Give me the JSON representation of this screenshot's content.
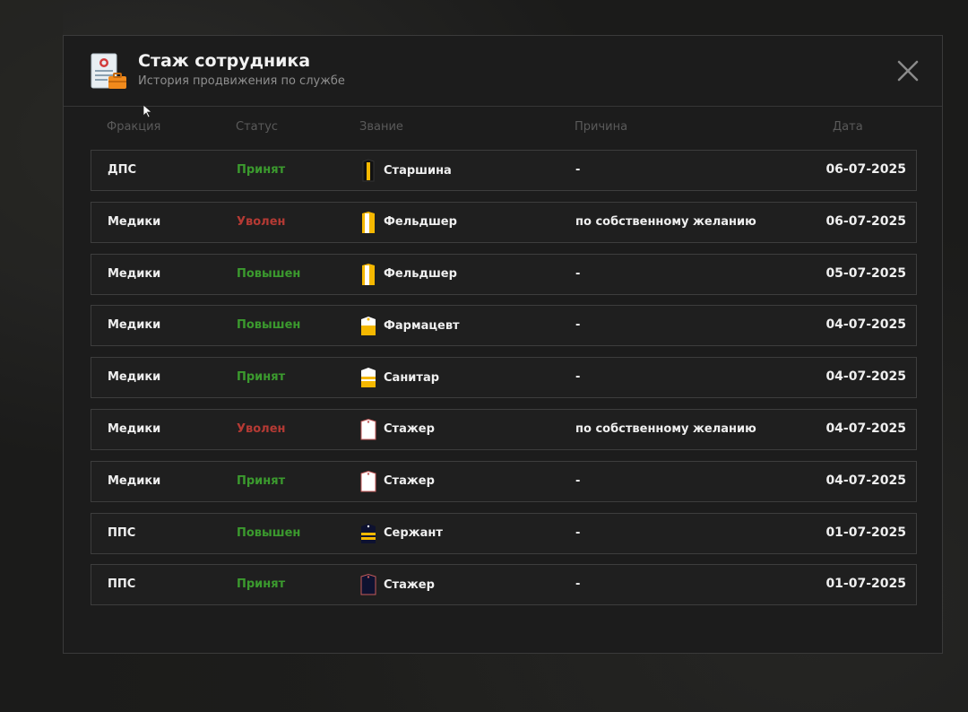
{
  "header": {
    "title": "Стаж сотрудника",
    "subtitle": "История продвижения по службе"
  },
  "columns": {
    "faction": "Фракция",
    "status": "Статус",
    "rank": "Звание",
    "reason": "Причина",
    "date": "Дата"
  },
  "rows": [
    {
      "faction": "ДПС",
      "status": "Принят",
      "status_type": "green",
      "rank": "Старшина",
      "rank_icon": "epaulette-black-gold-stripe-icon",
      "reason": "-",
      "date": "06-07-2025"
    },
    {
      "faction": "Медики",
      "status": "Уволен",
      "status_type": "red",
      "rank": "Фельдшер",
      "rank_icon": "epaulette-gold-white-stripe-icon",
      "reason": "по собственному желанию",
      "date": "06-07-2025"
    },
    {
      "faction": "Медики",
      "status": "Повышен",
      "status_type": "green",
      "rank": "Фельдшер",
      "rank_icon": "epaulette-gold-white-stripe-icon",
      "reason": "-",
      "date": "05-07-2025"
    },
    {
      "faction": "Медики",
      "status": "Повышен",
      "status_type": "green",
      "rank": "Фармацевт",
      "rank_icon": "epaulette-white-gold-bottom-icon",
      "reason": "-",
      "date": "04-07-2025"
    },
    {
      "faction": "Медики",
      "status": "Принят",
      "status_type": "green",
      "rank": "Санитар",
      "rank_icon": "epaulette-white-gold-bars-icon",
      "reason": "-",
      "date": "04-07-2025"
    },
    {
      "faction": "Медики",
      "status": "Уволен",
      "status_type": "red",
      "rank": "Стажер",
      "rank_icon": "epaulette-white-plain-icon",
      "reason": "по собственному желанию",
      "date": "04-07-2025"
    },
    {
      "faction": "Медики",
      "status": "Принят",
      "status_type": "green",
      "rank": "Стажер",
      "rank_icon": "epaulette-white-plain-icon",
      "reason": "-",
      "date": "04-07-2025"
    },
    {
      "faction": "ППС",
      "status": "Повышен",
      "status_type": "green",
      "rank": "Сержант",
      "rank_icon": "epaulette-navy-gold-bars-icon",
      "reason": "-",
      "date": "01-07-2025"
    },
    {
      "faction": "ППС",
      "status": "Принят",
      "status_type": "green",
      "rank": "Стажер",
      "rank_icon": "epaulette-navy-plain-icon",
      "reason": "-",
      "date": "01-07-2025"
    }
  ],
  "colors": {
    "accent_gold": "#f5b800",
    "status_green": "#3b9a2e",
    "status_red": "#b53a34"
  }
}
